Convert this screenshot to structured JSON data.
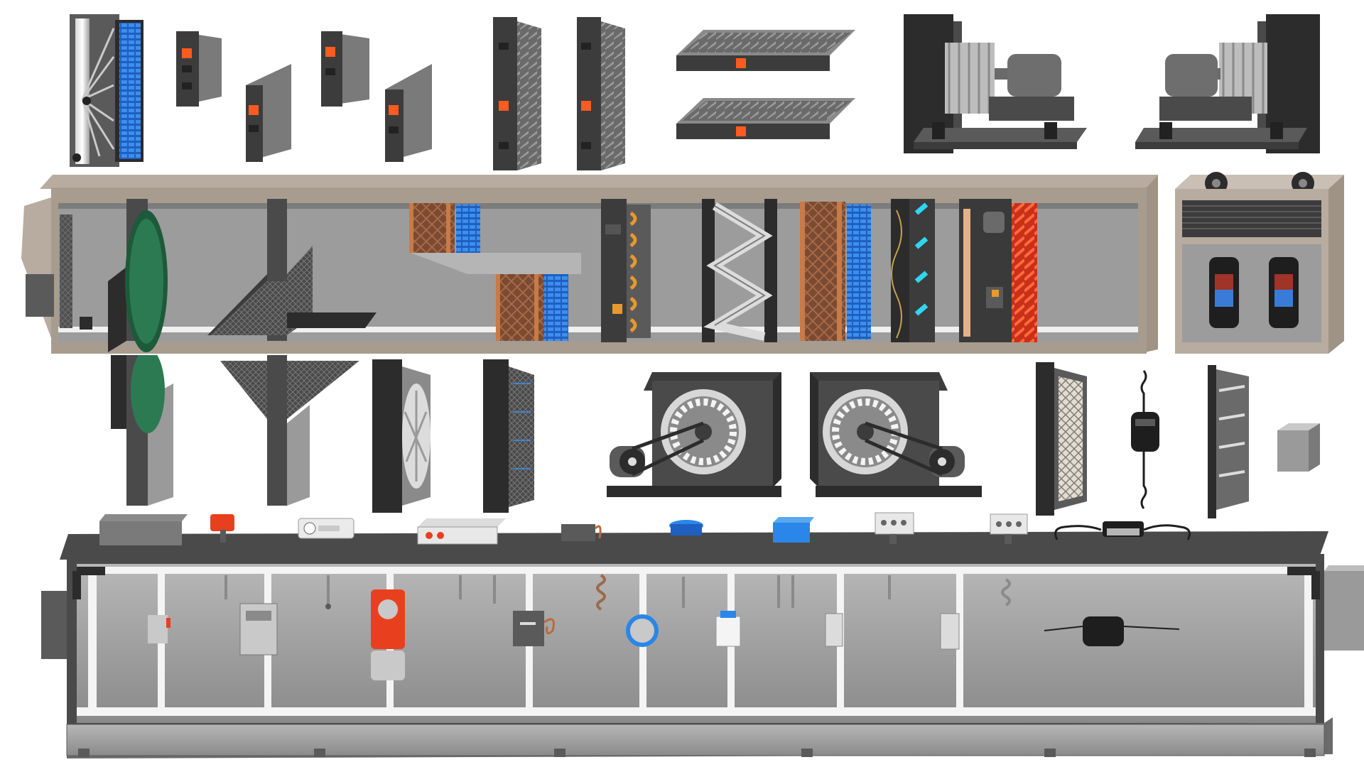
{
  "title": "",
  "colors": {
    "casing": "#b8aca0",
    "casing_dark": "#8f8376",
    "interior": "#9a9a9a",
    "interior_light": "#c6c6c6",
    "frame_white": "#f4f4f4",
    "dark_metal": "#3a3a3a",
    "coil_blue": "#2f7fe0",
    "copper": "#b86a3a",
    "damper_orange": "#ff5a1f",
    "filter_orange": "#e69a2a",
    "heater_red": "#e8401f",
    "uv_cyan": "#2fd6f2",
    "compressor_black": "#1e1e1e",
    "compressor_blue": "#3b7bd8",
    "sensor_blue": "#2a86e8"
  },
  "icons": {
    "component_palette": [
      "heat-pipe-coil-icon",
      "damper-small-icon",
      "damper-medium-icon",
      "damper-small-icon",
      "damper-medium-icon",
      "damper-tall-icon",
      "damper-tall-icon",
      "horizontal-damper-icon",
      "horizontal-damper-icon",
      "plenum-fan-motor-icon",
      "plenum-fan-motor-icon"
    ],
    "ahu_sections": [
      "heat-wheel-icon",
      "plate-heat-exchanger-icon",
      "cooling-coil-icon",
      "bag-filter-icon",
      "v-bank-filter-icon",
      "heating-coil-icon",
      "uv-lamp-icon",
      "electric-heater-icon"
    ],
    "mid_components": [
      "plug-fan-icon",
      "mesh-filter-icon",
      "belt-drive-fan-icon",
      "belt-drive-fan-icon",
      "panel-filter-icon",
      "flow-sensor-icon",
      "louver-damper-icon",
      "duct-transition-icon"
    ],
    "sensors": [
      "thermostat-icon",
      "pressure-switch-icon",
      "humidity-sensor-icon",
      "frost-thermostat-icon",
      "differential-pressure-icon",
      "pressure-transmitter-icon",
      "junction-box-icon",
      "temperature-probe-icon",
      "temperature-probe-icon",
      "airflow-station-icon"
    ]
  }
}
